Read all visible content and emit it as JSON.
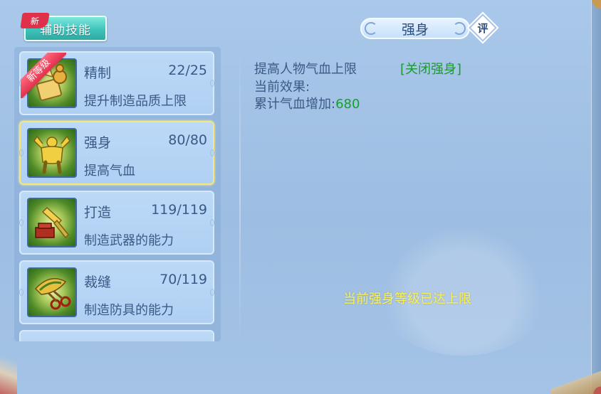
{
  "tab": {
    "new_badge": "新",
    "label": "辅助技能"
  },
  "skills": [
    {
      "name": "精制",
      "level": "22/25",
      "desc": "提升制造品质上限",
      "icon": "scroll-and-gourd-icon",
      "ribbon": "新等级"
    },
    {
      "name": "强身",
      "level": "80/80",
      "desc": "提高气血",
      "icon": "muscle-man-icon"
    },
    {
      "name": "打造",
      "level": "119/119",
      "desc": "制造武器的能力",
      "icon": "hammer-anvil-icon"
    },
    {
      "name": "裁缝",
      "level": "70/119",
      "desc": "制造防具的能力",
      "icon": "scissors-cloth-icon"
    }
  ],
  "detail": {
    "title": "强身",
    "rate_label": "评",
    "line1": "提高人物气血上限",
    "toggle": "[关闭强身]",
    "line2": "当前效果:",
    "line3_prefix": "累计气血增加:",
    "line3_value": "680",
    "max_notice": "当前强身等级已达上限"
  },
  "colors": {
    "text": "#3a5a86",
    "accent_green": "#1a9a2e",
    "notice_yellow": "#f7ef5a",
    "selected_border": "#f5e77a",
    "tab_teal": "#3ec4bb",
    "ribbon_red": "#e2304c"
  }
}
